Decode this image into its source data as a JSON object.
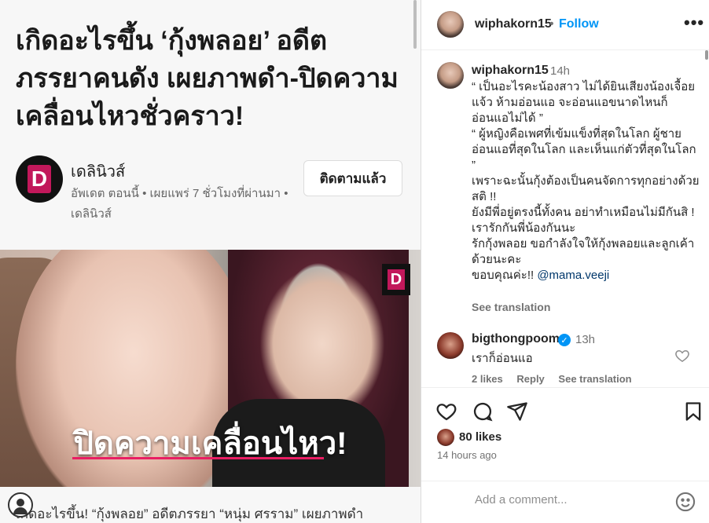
{
  "article": {
    "headline": "เกิดอะไรขึ้น ‘กุ้งพลอย’ อดีตภรรยาคนดัง เผยภาพดำ-ปิดความเคลื่อนไหวชั่วคราว!",
    "publisher_logo_letter": "D",
    "publisher_name": "เดลินิวส์",
    "meta": "อัพเดต ตอนนี้ • เผยแพร่ 7 ชั่วโมงที่ผ่านมา • เดลินิวส์",
    "follow_label": "ติดตามแล้ว",
    "hero_badge_letter": "D",
    "hero_caption": "ปิดความเคลื่อนไหว!",
    "snippet": "เกิดอะไรขึ้น! “กุ้งพลอย” อดีตภรรยา “หนุ่ม ศรราม” เผยภาพดำ"
  },
  "instagram": {
    "header": {
      "username": "wiphakorn15",
      "dot": "•",
      "follow_label": "Follow",
      "more_icon": "more-horizontal-icon"
    },
    "caption": {
      "username": "wiphakorn15",
      "time": "14h",
      "lines": [
        "“ เป็นอะไรคะน้องสาว ไม่ได้ยินเสียงน้องเจื้อยแจ้ว ห้ามอ่อนแอ จะอ่อนแอขนาดไหนก็อ่อนแอไม่ได้ ”",
        "“ ผู้หญิงคือเพศที่เข้มแข็งที่สุดในโลก ผู้ชายอ่อนแอที่สุดในโลก และเห็นแก่ตัวที่สุดในโลก ”",
        "เพราะฉะนั้นกุ้งต้องเป็นคนจัดการทุกอย่างด้วยสติ !!",
        "ยังมีพี่อยู่ตรงนี้ทั้งคน อย่าทำเหมือนไม่มีกันสิ !",
        "เรารักกันพี่น้องกันนะ",
        "รักกุ้งพลอย ขอกำลังใจให้กุ้งพลอยและลูกเค้าด้วยนะคะ"
      ],
      "last_line_text": "ขอบคุณค่ะ!! ",
      "mention": "@mama.veeji",
      "see_translation": "See translation"
    },
    "comment": {
      "username": "bigthongpoom",
      "verified": "✓",
      "time": "13h",
      "text": "เราก็อ่อนแอ",
      "likes": "2 likes",
      "reply": "Reply",
      "see_translation": "See translation"
    },
    "actions": {
      "icons": [
        "heart-icon",
        "comment-icon",
        "share-icon",
        "bookmark-icon"
      ],
      "likes": "80 likes",
      "age": "14 hours ago"
    },
    "add_comment": {
      "placeholder": "Add a comment..."
    }
  }
}
